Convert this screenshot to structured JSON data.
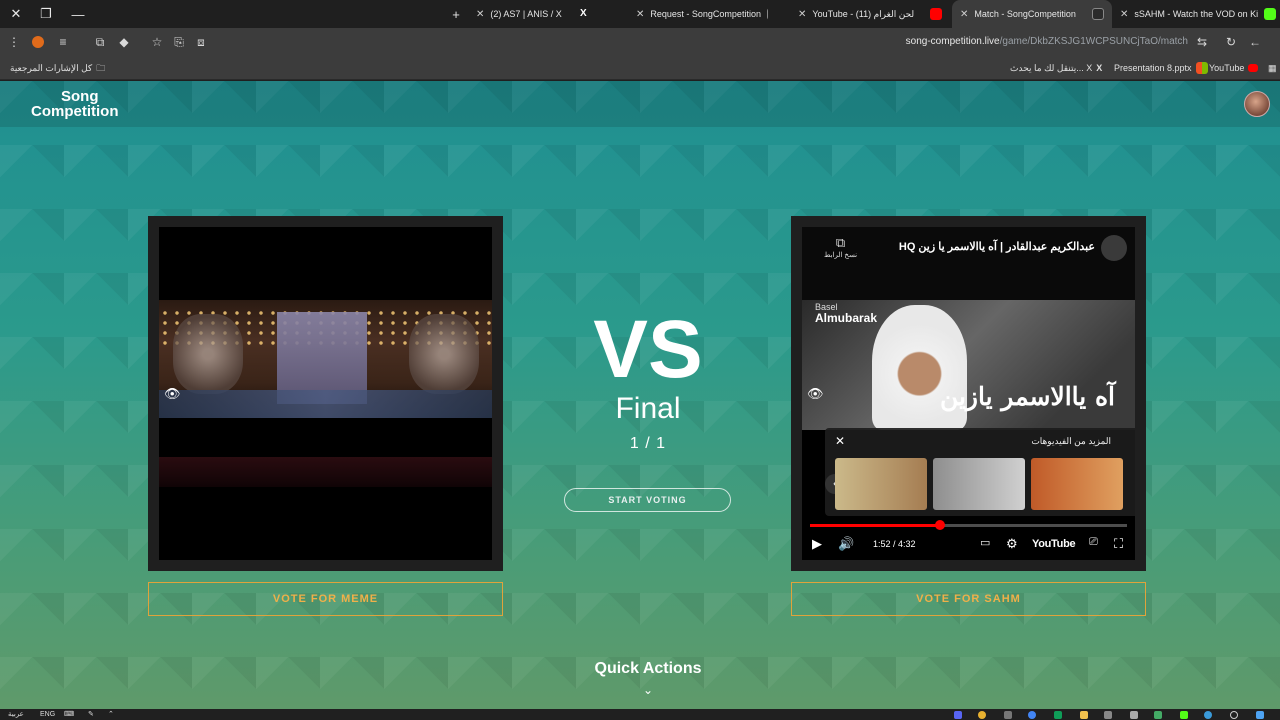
{
  "browser": {
    "tabs": [
      {
        "title": "(2) AS7 | ANIS / X",
        "favicon": "x-icon",
        "color": "#ffffff"
      },
      {
        "title": "Request - SongCompetition",
        "favicon": "songcompetition-icon",
        "color": "#8ab4f8"
      },
      {
        "title": "YouTube - (11) لحن الغرام",
        "favicon": "youtube-icon",
        "color": "#ff0000"
      },
      {
        "title": "Match - SongCompetition",
        "favicon": "songcompetition-icon",
        "color": "#8ab4f8",
        "active": true
      },
      {
        "title": "sSAHM - Watch the VOD on Ki",
        "favicon": "kick-icon",
        "color": "#53fc18"
      }
    ],
    "url_domain": "song-competition.live",
    "url_path": "/game/DkbZKSJG1WCPSUNCjTaO/match",
    "bookmarks": {
      "folder_label": "كل الإشارات المرجعية",
      "items": [
        {
          "label": "يتنقل لك ما يحدث... X",
          "icon": "x-icon"
        },
        {
          "label": "Presentation 8.pptx",
          "icon": "office-icon"
        },
        {
          "label": "YouTube",
          "icon": "youtube-icon"
        }
      ]
    }
  },
  "site": {
    "logo_line1": "Song",
    "logo_line2": "Competition"
  },
  "match": {
    "vs": "VS",
    "stage": "Final",
    "round": "1 / 1",
    "start_voting": "START VOTING",
    "vote_left": "VOTE FOR MEME",
    "vote_right": "VOTE FOR SAHM",
    "quick_actions": "Quick Actions"
  },
  "right_video": {
    "title": "عبدالكريم عبدالقادر | آه ياالاسمر يا زين HQ",
    "copy_link_label": "نسخ الرابط",
    "brand_small": "Basel",
    "brand_big": "Almubarak",
    "overlay_text": "آه ياالاسمر يازين",
    "more_videos_label": "المزيد من الفيديوهات",
    "time": "1:52 / 4:32",
    "progress": 0.41,
    "player_brand": "YouTube"
  },
  "taskbar": {
    "lang": "ENG",
    "lang_sub": "عربية"
  },
  "colors": {
    "vote_accent": "#f0b049",
    "page_teal": "#1f8f91",
    "page_green": "#5f9a6a"
  }
}
